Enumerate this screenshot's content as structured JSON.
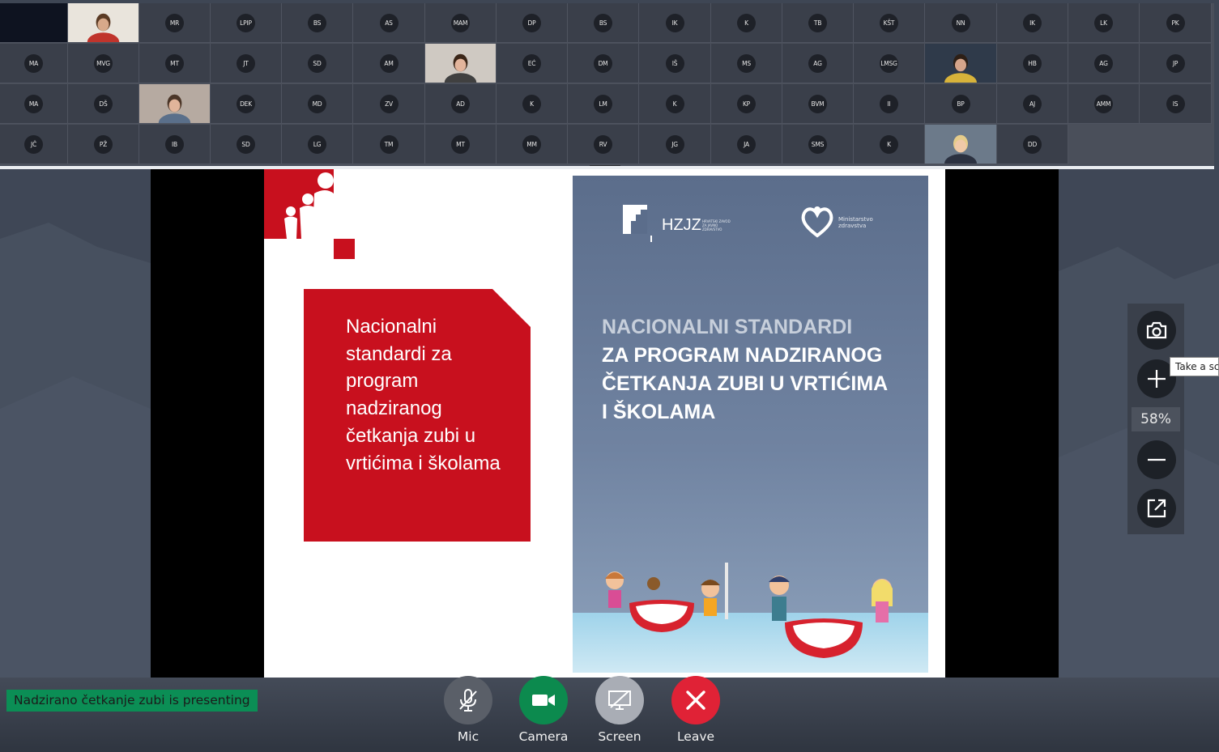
{
  "participants": {
    "rows": [
      [
        {
          "type": "blank"
        },
        {
          "type": "video"
        },
        {
          "type": "avatar",
          "initials": "MR"
        },
        {
          "type": "avatar",
          "initials": "LPIP"
        },
        {
          "type": "avatar",
          "initials": "BS"
        },
        {
          "type": "avatar",
          "initials": "AS"
        },
        {
          "type": "avatar",
          "initials": "MAM"
        },
        {
          "type": "avatar",
          "initials": "DP"
        },
        {
          "type": "avatar",
          "initials": "BS"
        },
        {
          "type": "avatar",
          "initials": "IK"
        },
        {
          "type": "avatar",
          "initials": "K"
        },
        {
          "type": "avatar",
          "initials": "TB"
        },
        {
          "type": "avatar",
          "initials": "KŠT"
        },
        {
          "type": "avatar",
          "initials": "NN"
        },
        {
          "type": "avatar",
          "initials": "IK"
        },
        {
          "type": "avatar",
          "initials": "LK"
        },
        {
          "type": "avatar",
          "initials": "PK"
        }
      ],
      [
        {
          "type": "avatar",
          "initials": "MA"
        },
        {
          "type": "avatar",
          "initials": "MVG"
        },
        {
          "type": "avatar",
          "initials": "MT"
        },
        {
          "type": "avatar",
          "initials": "JT"
        },
        {
          "type": "avatar",
          "initials": "SD"
        },
        {
          "type": "avatar",
          "initials": "AM"
        },
        {
          "type": "video"
        },
        {
          "type": "avatar",
          "initials": "EĆ"
        },
        {
          "type": "avatar",
          "initials": "DM"
        },
        {
          "type": "avatar",
          "initials": "IŠ"
        },
        {
          "type": "avatar",
          "initials": "MS"
        },
        {
          "type": "avatar",
          "initials": "AG"
        },
        {
          "type": "avatar",
          "initials": "LMSG"
        },
        {
          "type": "video"
        },
        {
          "type": "avatar",
          "initials": "HB"
        },
        {
          "type": "avatar",
          "initials": "AG"
        },
        {
          "type": "avatar",
          "initials": "JP"
        }
      ],
      [
        {
          "type": "avatar",
          "initials": "MA"
        },
        {
          "type": "avatar",
          "initials": "DŠ"
        },
        {
          "type": "video"
        },
        {
          "type": "avatar",
          "initials": "DEK"
        },
        {
          "type": "avatar",
          "initials": "MD"
        },
        {
          "type": "avatar",
          "initials": "ZV"
        },
        {
          "type": "avatar",
          "initials": "AD"
        },
        {
          "type": "avatar",
          "initials": "K"
        },
        {
          "type": "avatar",
          "initials": "LM"
        },
        {
          "type": "avatar",
          "initials": "K"
        },
        {
          "type": "avatar",
          "initials": "KP"
        },
        {
          "type": "avatar",
          "initials": "BVM"
        },
        {
          "type": "avatar",
          "initials": "II"
        },
        {
          "type": "avatar",
          "initials": "BP"
        },
        {
          "type": "avatar",
          "initials": "AJ"
        },
        {
          "type": "avatar",
          "initials": "AMM"
        },
        {
          "type": "avatar",
          "initials": "IS"
        }
      ],
      [
        {
          "type": "avatar",
          "initials": "JČ"
        },
        {
          "type": "avatar",
          "initials": "PŽ"
        },
        {
          "type": "avatar",
          "initials": "IB"
        },
        {
          "type": "avatar",
          "initials": "SD"
        },
        {
          "type": "avatar",
          "initials": "LG"
        },
        {
          "type": "avatar",
          "initials": "TM"
        },
        {
          "type": "avatar",
          "initials": "MT"
        },
        {
          "type": "avatar",
          "initials": "MM"
        },
        {
          "type": "avatar",
          "initials": "RV"
        },
        {
          "type": "avatar",
          "initials": "JG"
        },
        {
          "type": "avatar",
          "initials": "JA"
        },
        {
          "type": "avatar",
          "initials": "SMS"
        },
        {
          "type": "avatar",
          "initials": "K"
        },
        {
          "type": "video"
        },
        {
          "type": "avatar",
          "initials": "DD"
        }
      ]
    ]
  },
  "slide": {
    "left_title": "Nacionalni standardi za program nadziranog četkanja zubi u vrtićima i školama",
    "cover": {
      "logo_text": "HZJZ",
      "logo_small_text": "HRVATSKI ZAVOD ZA JAVNO ZDRAVSTVO",
      "ministry_text_1": "Ministarstvo",
      "ministry_text_2": "zdravstva",
      "title_line_1": "NACIONALNI STANDARDI",
      "title_line_2": "ZA PROGRAM NADZIRANOG",
      "title_line_3": "ČETKANJA ZUBI U VRTIĆIMA",
      "title_line_4": "I ŠKOLAMA"
    }
  },
  "zoom": {
    "level": "58%",
    "tooltip": "Take a screenshot",
    "icons": [
      "camera-icon",
      "plus-icon",
      "minus-icon",
      "popout-icon"
    ]
  },
  "presenting_banner": "Nadzirano četkanje zubi is presenting",
  "controls": [
    {
      "id": "mic",
      "label": "Mic",
      "icon": "mic-off-icon",
      "color": "#5a5f68"
    },
    {
      "id": "camera",
      "label": "Camera",
      "icon": "video-camera-icon",
      "color": "#0c8a4e"
    },
    {
      "id": "screen",
      "label": "Screen",
      "icon": "screen-share-off-icon",
      "color": "#a9adb5"
    },
    {
      "id": "leave",
      "label": "Leave",
      "icon": "close-icon",
      "color": "#e02236"
    }
  ]
}
